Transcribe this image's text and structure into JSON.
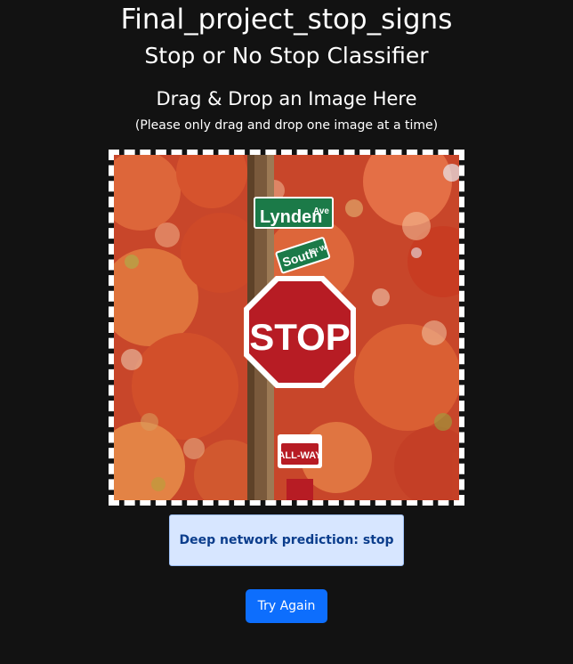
{
  "page": {
    "title": "Final_project_stop_signs",
    "subtitle": "Stop or No Stop Classifier"
  },
  "dropzone": {
    "heading": "Drag & Drop an Image Here",
    "note": "(Please only drag and drop one image at a time)",
    "image": {
      "street_sign_top": "Lynden",
      "street_sign_top_suffix": "Ave",
      "street_sign_bottom": "South",
      "street_sign_bottom_suffix": "St W",
      "stop_sign_text": "STOP",
      "all_way_text": "ALL-WAY"
    }
  },
  "result": {
    "prediction_text": "Deep network prediction: stop"
  },
  "actions": {
    "try_again_label": "Try Again"
  },
  "colors": {
    "background": "#121212",
    "accent": "#0d6efd",
    "prediction_bg": "#d7e6ff",
    "prediction_text": "#0b3d8c"
  }
}
